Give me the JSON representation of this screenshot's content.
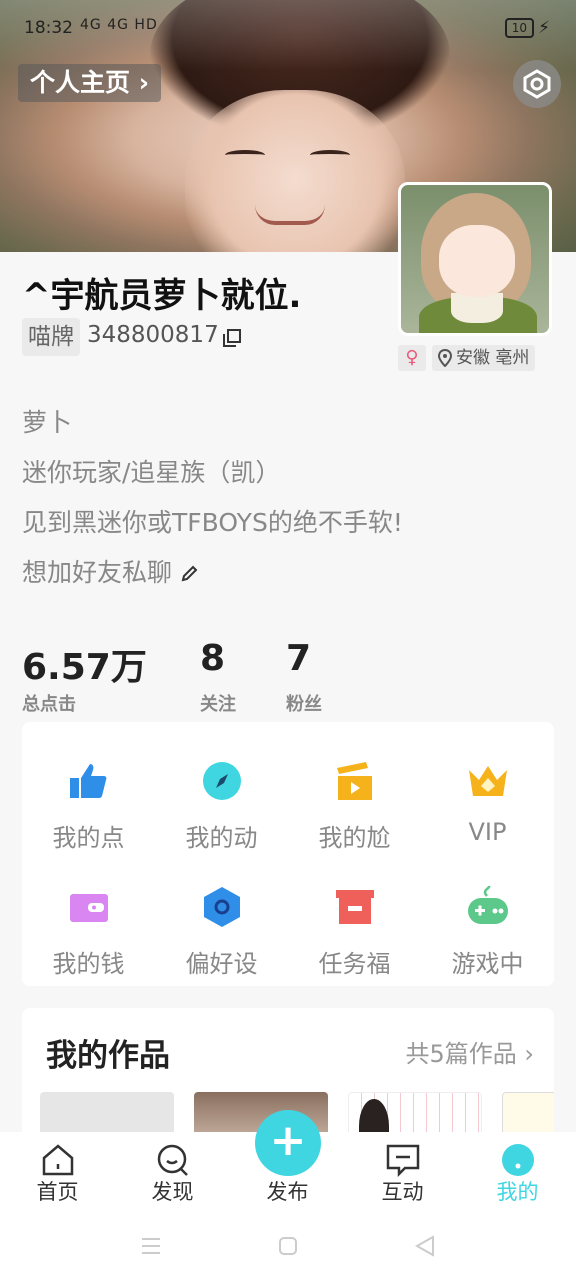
{
  "status_bar": {
    "time": "18:32",
    "signal": "4G 4G HD",
    "battery": "10"
  },
  "header": {
    "profile_link": "个人主页 ›"
  },
  "profile": {
    "nickname": "^宇航员萝卜就位.",
    "badge": "喵牌",
    "uid": "348800817",
    "gender_symbol": "♀",
    "location": "安徽 亳州",
    "bio": [
      "萝卜",
      "迷你玩家/追星族（凯）",
      "见到黑迷你或TFBOYS的绝不手软!",
      "想加好友私聊"
    ]
  },
  "stats": [
    {
      "value": "6.57万",
      "label": "总点击"
    },
    {
      "value": "8",
      "label": "关注"
    },
    {
      "value": "7",
      "label": "粉丝"
    }
  ],
  "grid": [
    {
      "label": "我的点",
      "icon": "thumbs-up-icon",
      "color": "#2f8fe8"
    },
    {
      "label": "我的动",
      "icon": "compass-icon",
      "color": "#3fd6e2"
    },
    {
      "label": "我的尬",
      "icon": "clapperboard-icon",
      "color": "#f6b21a"
    },
    {
      "label": "VIP",
      "icon": "crown-icon",
      "color": "#f6b21a"
    },
    {
      "label": "我的钱",
      "icon": "wallet-icon",
      "color": "#d986f2"
    },
    {
      "label": "偏好设",
      "icon": "hexagon-settings-icon",
      "color": "#2f8fe8"
    },
    {
      "label": "任务福",
      "icon": "gift-box-icon",
      "color": "#f0605a"
    },
    {
      "label": "游戏中",
      "icon": "gamepad-icon",
      "color": "#5cc98a"
    }
  ],
  "works": {
    "title": "我的作品",
    "count": "共5篇作品 ›"
  },
  "bottom_nav": [
    {
      "label": "首页",
      "icon": "home-icon"
    },
    {
      "label": "发现",
      "icon": "discover-search-icon"
    },
    {
      "label": "发布",
      "icon": "plus-icon"
    },
    {
      "label": "互动",
      "icon": "message-icon"
    },
    {
      "label": "我的",
      "icon": "profile-icon"
    }
  ],
  "publish_symbol": "+",
  "accent_color": "#3fd6e2"
}
